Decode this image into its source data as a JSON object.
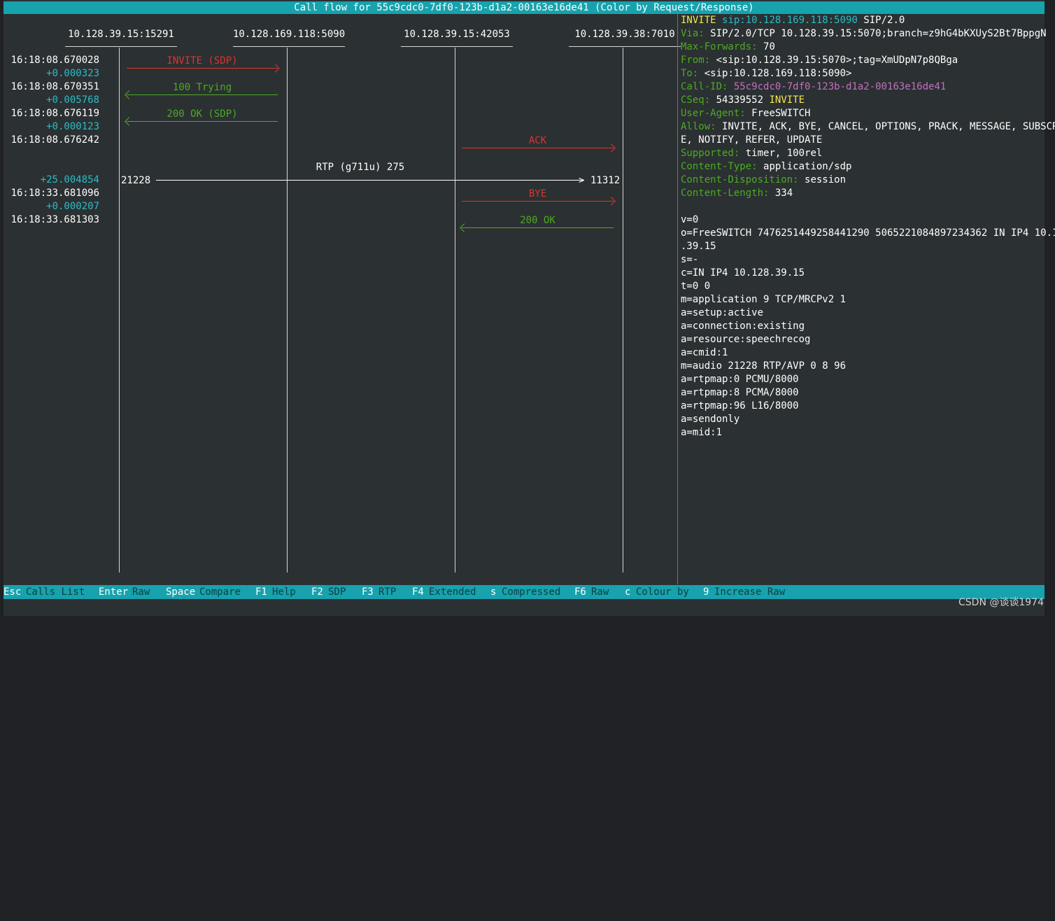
{
  "window": {
    "title": "Call flow for 55c9cdc0-7df0-123b-d1a2-00163e16de41 (Color by Request/Response)"
  },
  "hosts": [
    "10.128.39.15:15291",
    "10.128.169.118:5090",
    "10.128.39.15:42053",
    "10.128.39.38:7010"
  ],
  "timestamps": [
    {
      "abs": "16:18:08.670028",
      "delta": "+0.000323"
    },
    {
      "abs": "16:18:08.670351",
      "delta": "+0.005768"
    },
    {
      "abs": "16:18:08.676119",
      "delta": "+0.000123"
    },
    {
      "abs": "16:18:08.676242",
      "delta": ""
    },
    {
      "abs": "",
      "delta": "+25.004854"
    },
    {
      "abs": "16:18:33.681096",
      "delta": "+0.000207"
    },
    {
      "abs": "16:18:33.681303",
      "delta": ""
    }
  ],
  "messages": [
    {
      "label": "INVITE (SDP)",
      "kind": "request",
      "color": "#e0332c"
    },
    {
      "label": "100 Trying",
      "kind": "response",
      "color": "#4cab22"
    },
    {
      "label": "200 OK (SDP)",
      "kind": "response",
      "color": "#4cab22"
    },
    {
      "label": "ACK",
      "kind": "request",
      "color": "#e0332c"
    },
    {
      "label": "BYE",
      "kind": "request",
      "color": "#e0332c"
    },
    {
      "label": "200 OK",
      "kind": "response",
      "color": "#4cab22"
    }
  ],
  "rtp": {
    "label": "RTP (g711u) 275",
    "src_port": "21228",
    "dst_port": "11312"
  },
  "detail": {
    "request_line": {
      "method": "INVITE",
      "uri": "sip:10.128.169.118:5090",
      "version": "SIP/2.0"
    },
    "headers": [
      {
        "name": "Via:",
        "value": "SIP/2.0/TCP 10.128.39.15:5070;branch=z9hG4bKXUyS2Bt7BppgN"
      },
      {
        "name": "Max-Forwards:",
        "value": "70"
      },
      {
        "name": "From:",
        "value": "<sip:10.128.39.15:5070>;tag=XmUDpN7p8QBga"
      },
      {
        "name": "To:",
        "value": "<sip:10.128.169.118:5090>"
      },
      {
        "name": "Call-ID:",
        "value": "55c9cdc0-7df0-123b-d1a2-00163e16de41"
      },
      {
        "name": "CSeq:",
        "value": "54339552",
        "value2": "INVITE"
      },
      {
        "name": "User-Agent:",
        "value": "FreeSWITCH"
      },
      {
        "name": "Allow:",
        "value": "INVITE, ACK, BYE, CANCEL, OPTIONS, PRACK, MESSAGE, SUBSCR"
      },
      {
        "name": "",
        "value": "E, NOTIFY, REFER, UPDATE"
      },
      {
        "name": "Supported:",
        "value": "timer, 100rel"
      },
      {
        "name": "Content-Type:",
        "value": "application/sdp"
      },
      {
        "name": "Content-Disposition:",
        "value": "session"
      },
      {
        "name": "Content-Length:",
        "value": "334"
      }
    ],
    "body": [
      "v=0",
      "o=FreeSWITCH 7476251449258441290 5065221084897234362 IN IP4 10.1",
      ".39.15",
      "s=-",
      "c=IN IP4 10.128.39.15",
      "t=0 0",
      "m=application 9 TCP/MRCPv2 1",
      "a=setup:active",
      "a=connection:existing",
      "a=resource:speechrecog",
      "a=cmid:1",
      "m=audio 21228 RTP/AVP 0 8 96",
      "a=rtpmap:0 PCMU/8000",
      "a=rtpmap:8 PCMA/8000",
      "a=rtpmap:96 L16/8000",
      "a=sendonly",
      "a=mid:1"
    ]
  },
  "footer": [
    {
      "key": "Esc",
      "action": "Calls List"
    },
    {
      "key": "Enter",
      "action": "Raw"
    },
    {
      "key": "Space",
      "action": "Compare"
    },
    {
      "key": "F1",
      "action": "Help"
    },
    {
      "key": "F2",
      "action": "SDP"
    },
    {
      "key": "F3",
      "action": "RTP"
    },
    {
      "key": "F4",
      "action": "Extended"
    },
    {
      "key": "s",
      "action": "Compressed"
    },
    {
      "key": "F6",
      "action": "Raw"
    },
    {
      "key": "c",
      "action": "Colour by"
    },
    {
      "key": "9",
      "action": "Increase Raw"
    }
  ],
  "watermark": "CSDN @谈谈1974"
}
